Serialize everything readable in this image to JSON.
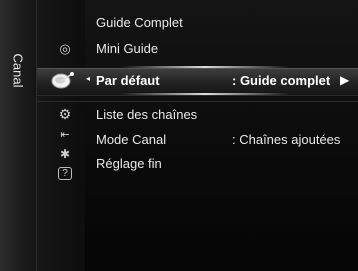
{
  "sidebar": {
    "label": "Canal"
  },
  "menu": {
    "items": [
      {
        "label": "Guide Complet"
      },
      {
        "label": "Mini Guide"
      },
      {
        "label": "Par défaut",
        "value": ": Guide complet"
      },
      {
        "label": "Liste des chaînes"
      },
      {
        "label": "Mode Canal",
        "value": ": Chaînes ajoutées"
      },
      {
        "label": "Réglage fin"
      }
    ],
    "selected_index": 2
  },
  "icons": {
    "picture": "picture-icon",
    "channel": "satellite-dish-icon",
    "setup": "gear-icon",
    "input": "input-icon",
    "application": "application-icon",
    "support": "help-icon"
  },
  "glyphs": {
    "arrow_left": "◂",
    "arrow_right": "▶",
    "picture": "◎",
    "setup": "⚙",
    "input": "⇤",
    "application": "✱",
    "support": "?"
  },
  "colors": {
    "background": "#0b0b0b",
    "text": "#e9e9e9",
    "selected_text": "#ffffff"
  }
}
